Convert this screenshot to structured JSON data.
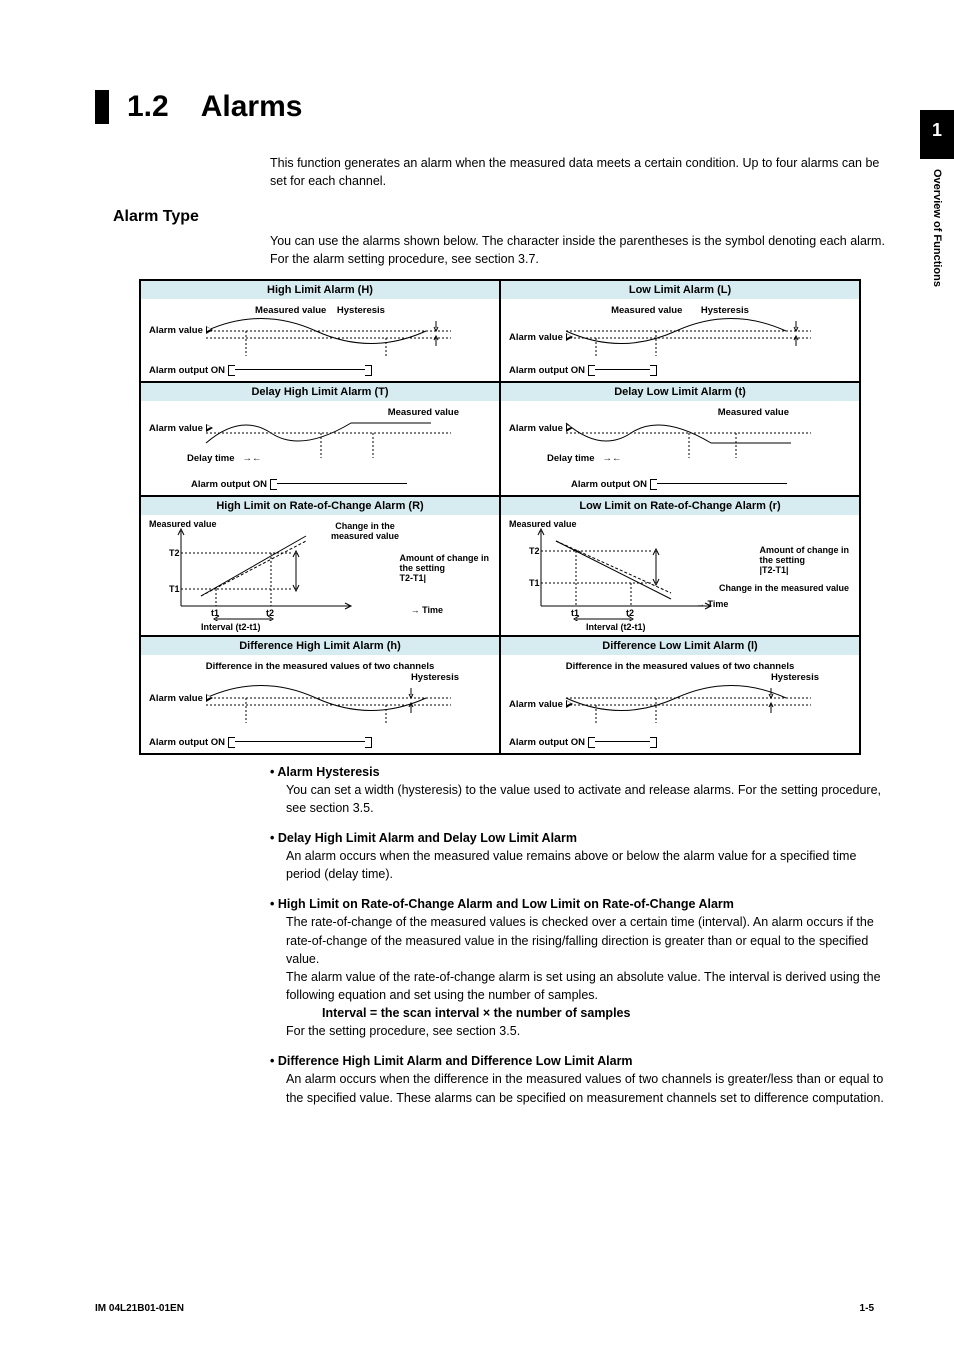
{
  "sideTab": {
    "num": "1",
    "text": "Overview of Functions"
  },
  "heading": {
    "num": "1.2",
    "title": "Alarms"
  },
  "intro": "This function generates an alarm when the measured data meets a certain condition. Up to four alarms can be set for each channel.",
  "alarmType": {
    "title": "Alarm Type",
    "body1": "You can use the alarms shown below. The character inside the parentheses is the symbol denoting each alarm.",
    "body2": "For the alarm setting procedure, see section 3.7."
  },
  "dia": {
    "r1": {
      "hL": "High Limit Alarm (H)",
      "hR": "Low Limit Alarm (L)"
    },
    "r2": {
      "hL": "Delay High Limit Alarm (T)",
      "hR": "Delay Low Limit Alarm (t)"
    },
    "r3": {
      "hL": "High Limit on Rate-of-Change Alarm (R)",
      "hR": "Low Limit on Rate-of-Change Alarm (r)"
    },
    "r4": {
      "hL": "Difference High Limit Alarm (h)",
      "hR": "Difference Low Limit Alarm (l)"
    },
    "lbl": {
      "measured": "Measured value",
      "hyst": "Hysteresis",
      "alarmVal": "Alarm value",
      "alarmOut": "Alarm output ON",
      "delayTime": "Delay time",
      "change": "Change in the measured value",
      "changeIn": "Change in the",
      "changeIn2": "measured value",
      "amount": "Amount of change in",
      "amount2": "the setting",
      "t2t1": "T2-T1|",
      "t2t1b": "|T2-T1|",
      "T1": "T1",
      "T2": "T2",
      "tt1": "t1",
      "tt2": "t2",
      "time": "Time",
      "interval": "Interval (t2-t1)",
      "diff": "Difference in the measured values of two channels"
    }
  },
  "bullets": {
    "b1": {
      "t": "Alarm Hysteresis",
      "p": "You can set a width (hysteresis) to the value used to activate and release alarms. For the setting procedure, see section 3.5."
    },
    "b2": {
      "t": "Delay High Limit Alarm and Delay Low Limit Alarm",
      "p": "An alarm occurs when the measured value remains above or below the alarm value for a specified time period (delay time)."
    },
    "b3": {
      "t": "High Limit on Rate-of-Change Alarm and Low Limit on Rate-of-Change Alarm",
      "p1": "The rate-of-change of the measured values is checked over a certain time (interval). An alarm occurs if the rate-of-change of the measured value in the rising/falling direction is greater than or equal to the specified value.",
      "p2": "The alarm value of the rate-of-change alarm is set using an absolute value. The interval is derived using the following equation and set using the number of samples.",
      "formula": "Interval = the scan interval × the number of samples",
      "p3": "For the setting procedure, see section 3.5."
    },
    "b4": {
      "t": "Difference High Limit  Alarm and Difference Low Limit Alarm",
      "p": "An alarm occurs when the difference in the measured values of two channels is greater/less than or equal to the specified value. These alarms can be specified on measurement channels set to difference computation."
    }
  },
  "footer": {
    "left": "IM 04L21B01-01EN",
    "right": "1-5"
  }
}
